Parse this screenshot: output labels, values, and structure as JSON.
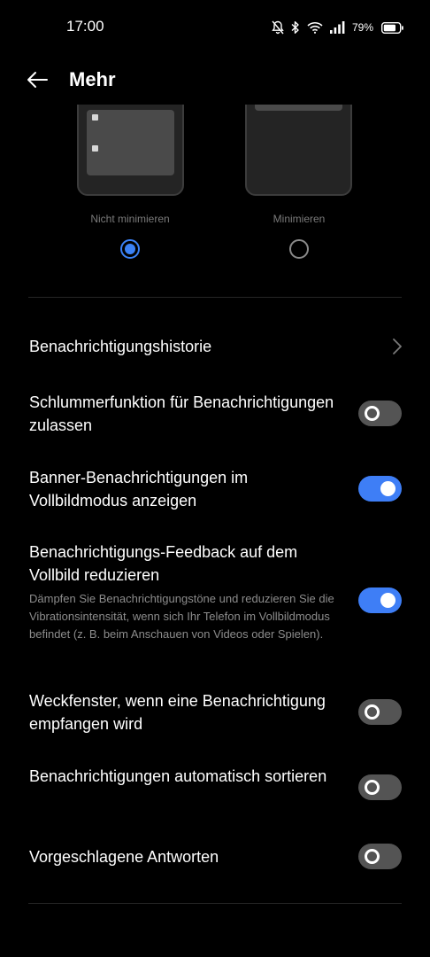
{
  "status_bar": {
    "time": "17:00",
    "battery": "79%",
    "icons": [
      "mute-bell-icon",
      "bluetooth-icon",
      "wifi-icon",
      "signal-icon",
      "battery-icon"
    ]
  },
  "header": {
    "title": "Mehr",
    "back_icon": "arrow-left-icon"
  },
  "preview": {
    "options": [
      {
        "label": "Nicht minimieren",
        "selected": true
      },
      {
        "label": "Minimieren",
        "selected": false
      }
    ]
  },
  "settings": {
    "history": {
      "title": "Benachrichtigungshistorie",
      "icon": "chevron-right-icon"
    },
    "snooze": {
      "title": "Schlummerfunktion für Benachrichtigungen zulassen",
      "enabled": false
    },
    "banner_fullscreen": {
      "title": "Banner-Benachrichtigungen im Vollbildmodus anzeigen",
      "enabled": true
    },
    "feedback_reduce": {
      "title": "Benachrichtigungs-Feedback auf dem Vollbild reduzieren",
      "description": "Dämpfen Sie Benachrichtigungstöne und reduzieren Sie die Vibrationsintensität, wenn sich Ihr Telefon im Vollbildmodus befindet (z. B. beim Anschauen von Videos oder Spielen).",
      "enabled": true
    },
    "wake_window": {
      "title": "Weckfenster, wenn eine Benachrichtigung empfangen wird",
      "enabled": false
    },
    "auto_sort": {
      "title": "Benachrichtigungen automatisch sortieren",
      "enabled": false
    },
    "suggested_replies": {
      "title": "Vorgeschlagene Antworten",
      "enabled": false
    }
  },
  "colors": {
    "accent": "#3e7ef6",
    "background": "#000000",
    "toggle_off": "#545454",
    "secondary_text": "#8c8c8c"
  }
}
